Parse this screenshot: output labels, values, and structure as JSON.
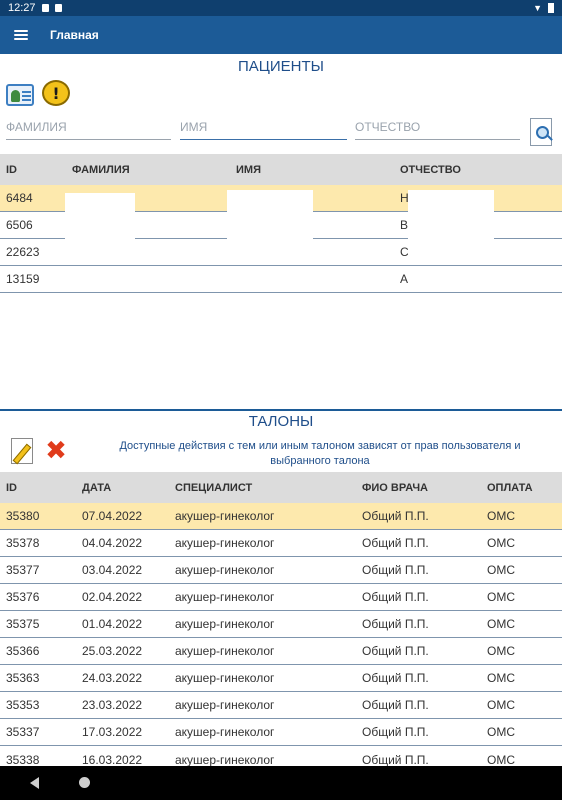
{
  "status_bar": {
    "time": "12:27"
  },
  "app_bar": {
    "title": "Главная"
  },
  "patients": {
    "title": "ПАЦИЕНТЫ",
    "search": {
      "surname_placeholder": "ФАМИЛИЯ",
      "name_placeholder": "ИМЯ",
      "patronymic_placeholder": "ОТЧЕСТВО"
    },
    "columns": [
      "ID",
      "ФАМИЛИЯ",
      "ИМЯ",
      "ОТЧЕСТВО"
    ],
    "rows": [
      {
        "id": "6484",
        "surname": "",
        "name": "",
        "patronymic": "Н",
        "selected": true
      },
      {
        "id": "6506",
        "surname": "",
        "name": "",
        "patronymic": "В",
        "selected": false
      },
      {
        "id": "22623",
        "surname": "",
        "name": "",
        "patronymic": "С",
        "selected": false
      },
      {
        "id": "13159",
        "surname": "",
        "name": "",
        "patronymic": "А",
        "selected": false
      }
    ]
  },
  "talons": {
    "title": "ТАЛОНЫ",
    "info": "Доступные действия с тем или иным талоном зависят от прав пользователя и выбранного талона",
    "columns": [
      "ID",
      "ДАТА",
      "СПЕЦИАЛИСТ",
      "ФИО ВРАЧА",
      "ОПЛАТА"
    ],
    "rows": [
      {
        "id": "35380",
        "date": "07.04.2022",
        "specialist": "акушер-гинеколог",
        "doctor": "Общий П.П.",
        "payment": "ОМС",
        "selected": true
      },
      {
        "id": "35378",
        "date": "04.04.2022",
        "specialist": "акушер-гинеколог",
        "doctor": "Общий П.П.",
        "payment": "ОМС",
        "selected": false
      },
      {
        "id": "35377",
        "date": "03.04.2022",
        "specialist": "акушер-гинеколог",
        "doctor": "Общий П.П.",
        "payment": "ОМС",
        "selected": false
      },
      {
        "id": "35376",
        "date": "02.04.2022",
        "specialist": "акушер-гинеколог",
        "doctor": "Общий П.П.",
        "payment": "ОМС",
        "selected": false
      },
      {
        "id": "35375",
        "date": "01.04.2022",
        "specialist": "акушер-гинеколог",
        "doctor": "Общий П.П.",
        "payment": "ОМС",
        "selected": false
      },
      {
        "id": "35366",
        "date": "25.03.2022",
        "specialist": "акушер-гинеколог",
        "doctor": "Общий П.П.",
        "payment": "ОМС",
        "selected": false
      },
      {
        "id": "35363",
        "date": "24.03.2022",
        "specialist": "акушер-гинеколог",
        "doctor": "Общий П.П.",
        "payment": "ОМС",
        "selected": false
      },
      {
        "id": "35353",
        "date": "23.03.2022",
        "specialist": "акушер-гинеколог",
        "doctor": "Общий П.П.",
        "payment": "ОМС",
        "selected": false
      },
      {
        "id": "35337",
        "date": "17.03.2022",
        "specialist": "акушер-гинеколог",
        "doctor": "Общий П.П.",
        "payment": "ОМС",
        "selected": false
      },
      {
        "id": "35338",
        "date": "16.03.2022",
        "specialist": "акушер-гинеколог",
        "doctor": "Общий П.П.",
        "payment": "ОМС",
        "selected": false
      }
    ]
  },
  "colors": {
    "status_bar": "#0f3f6e",
    "app_bar": "#1c5b97",
    "header_gray": "#dcdcdc",
    "selected_row": "#fde9ad",
    "section_title": "#1f4e8a"
  }
}
